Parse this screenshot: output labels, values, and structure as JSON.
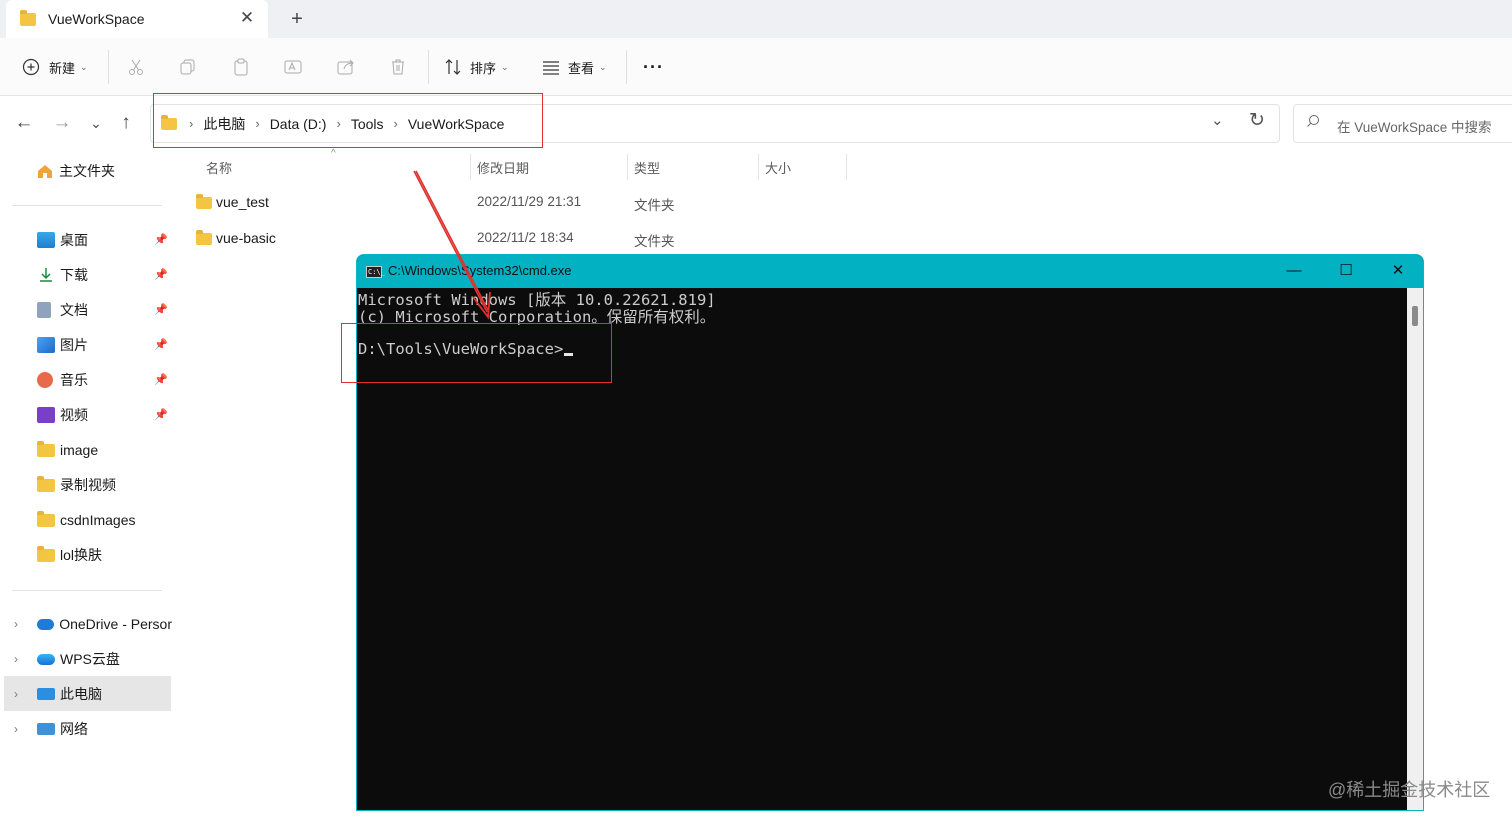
{
  "tab": {
    "title": "VueWorkSpace",
    "close": "✕",
    "new": "+"
  },
  "toolbar": {
    "new_label": "新建",
    "sort_label": "排序",
    "view_label": "查看",
    "more_label": "···"
  },
  "address": {
    "crumbs": [
      "此电脑",
      "Data (D:)",
      "Tools",
      "VueWorkSpace"
    ],
    "sep": "›"
  },
  "search": {
    "placeholder": "在 VueWorkSpace 中搜索"
  },
  "sidebar": {
    "home": "主文件夹",
    "quick": [
      {
        "label": "桌面"
      },
      {
        "label": "下载"
      },
      {
        "label": "文档"
      },
      {
        "label": "图片"
      },
      {
        "label": "音乐"
      },
      {
        "label": "视频"
      },
      {
        "label": "image"
      },
      {
        "label": "录制视频"
      },
      {
        "label": "csdnImages"
      },
      {
        "label": "lol换肤"
      }
    ],
    "locations": [
      {
        "label": "OneDrive - Persor"
      },
      {
        "label": "WPS云盘"
      },
      {
        "label": "此电脑"
      },
      {
        "label": "网络"
      }
    ]
  },
  "columns": {
    "name": "名称",
    "date": "修改日期",
    "type": "类型",
    "size": "大小"
  },
  "files": [
    {
      "name": "vue_test",
      "date": "2022/11/29 21:31",
      "type": "文件夹"
    },
    {
      "name": "vue-basic",
      "date": "2022/11/2 18:34",
      "type": "文件夹"
    }
  ],
  "cmd": {
    "title": "C:\\Windows\\System32\\cmd.exe",
    "icon_text": "C:\\_",
    "minimize": "—",
    "maximize": "☐",
    "close": "✕",
    "lines": [
      "Microsoft Windows [版本 10.0.22621.819]",
      "(c) Microsoft Corporation。保留所有权利。",
      "",
      "D:\\Tools\\VueWorkSpace>"
    ]
  },
  "watermark": "@稀土掘金技术社区",
  "colors": {
    "highlight": "#e0312f",
    "cmd_titlebar": "#03b2c2",
    "folder": "#f4c542"
  }
}
